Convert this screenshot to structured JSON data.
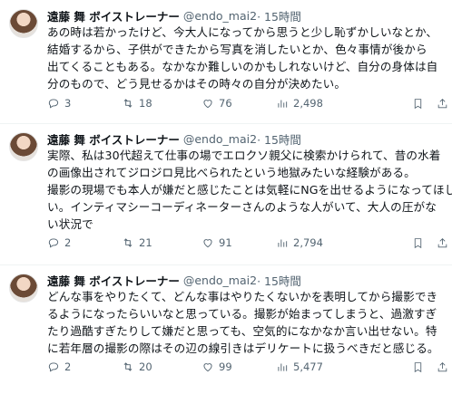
{
  "tweets": [
    {
      "display_name": "遠藤 舞 ボイストレーナー",
      "handle": "@endo_mai2",
      "time": "· 15時間",
      "lines": [
        "あの時は若かったけど、今大人になってから思うと少し恥ずかしいなとか、",
        "結婚するから、子供ができたから写真を消したいとか、色々事情が後から",
        "出てくることもある。なかなか難しいのかもしれないけど、自分の身体は自",
        "分のもので、どう見せるかはその時々の自分が決めたい。"
      ],
      "replies": "3",
      "retweets": "18",
      "likes": "76",
      "views": "2,498"
    },
    {
      "display_name": "遠藤 舞 ボイストレーナー",
      "handle": "@endo_mai2",
      "time": "· 15時間",
      "lines": [
        "実際、私は30代超えて仕事の場でエロクソ親父に検索かけられて、昔の水着",
        "の画像出されてジロジロ見比べられたという地獄みたいな経験がある。",
        "撮影の現場でも本人が嫌だと感じたことは気軽にNGを出せるようになってほし",
        "い。インティマシーコーディネーターさんのような人がいて、大人の圧がな",
        "い状況で"
      ],
      "replies": "2",
      "retweets": "21",
      "likes": "91",
      "views": "2,794"
    },
    {
      "display_name": "遠藤 舞 ボイストレーナー",
      "handle": "@endo_mai2",
      "time": "· 15時間",
      "lines": [
        "どんな事をやりたくて、どんな事はやりたくないかを表明してから撮影でき",
        "るようになったらいいなと思っている。撮影が始まってしまうと、過激すぎ",
        "たり過酷すぎたりして嫌だと思っても、空気的になかなか言い出せない。特",
        "に若年層の撮影の際はその辺の線引きはデリケートに扱うべきだと感じる。"
      ],
      "replies": "2",
      "retweets": "20",
      "likes": "99",
      "views": "5,477"
    }
  ]
}
